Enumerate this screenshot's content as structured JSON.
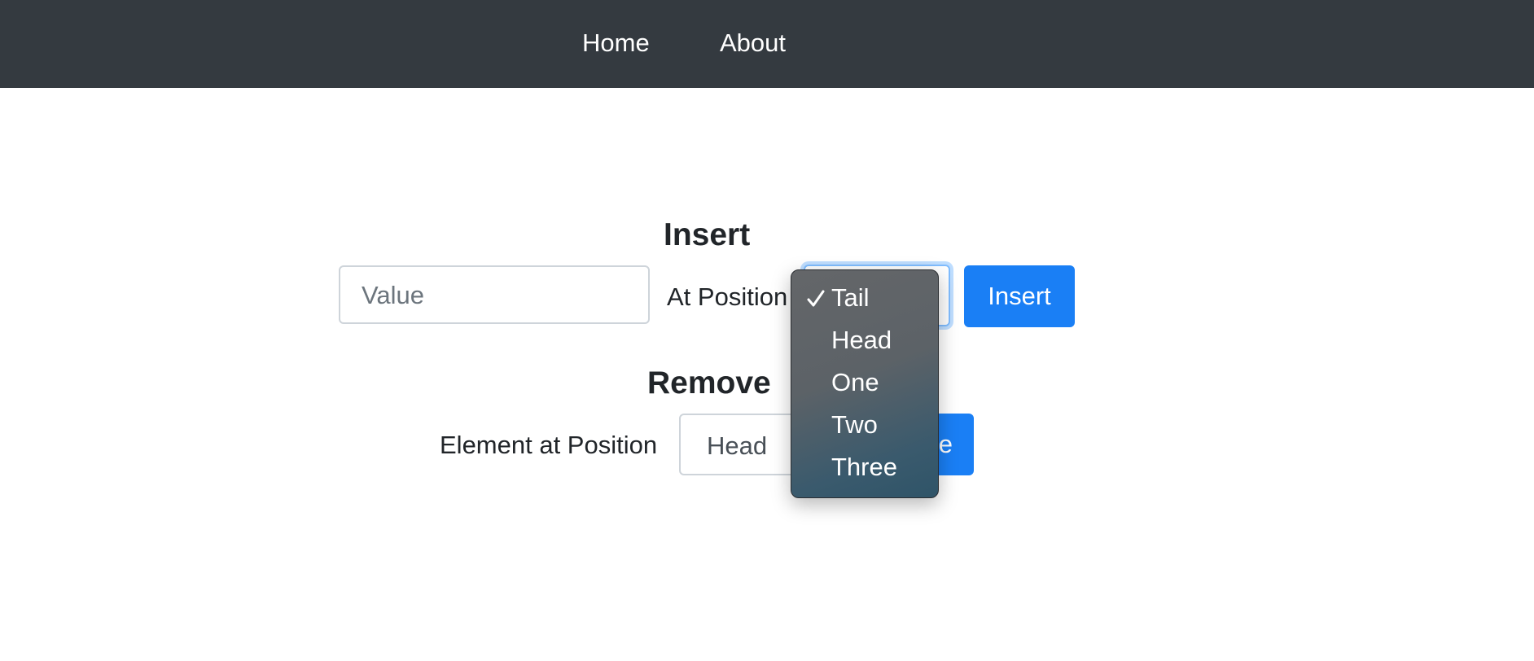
{
  "navbar": {
    "links": [
      {
        "label": "Home"
      },
      {
        "label": "About"
      }
    ]
  },
  "insert": {
    "heading": "Insert",
    "value_placeholder": "Value",
    "position_label": "At Position",
    "position_select": {
      "selected": "Tail",
      "options": [
        "Tail",
        "Head",
        "One",
        "Two",
        "Three"
      ],
      "open": true
    },
    "button_label": "Insert"
  },
  "remove": {
    "heading": "Remove",
    "position_label": "Element at Position",
    "position_select": {
      "selected": "Head"
    },
    "button_label": "Remove",
    "button_visible_text": "e"
  },
  "colors": {
    "navbar_bg": "#343a40",
    "primary": "#1a7ff5"
  },
  "icons": {
    "selected_check": "check-icon",
    "select_chevron": "chevron-down-icon"
  }
}
